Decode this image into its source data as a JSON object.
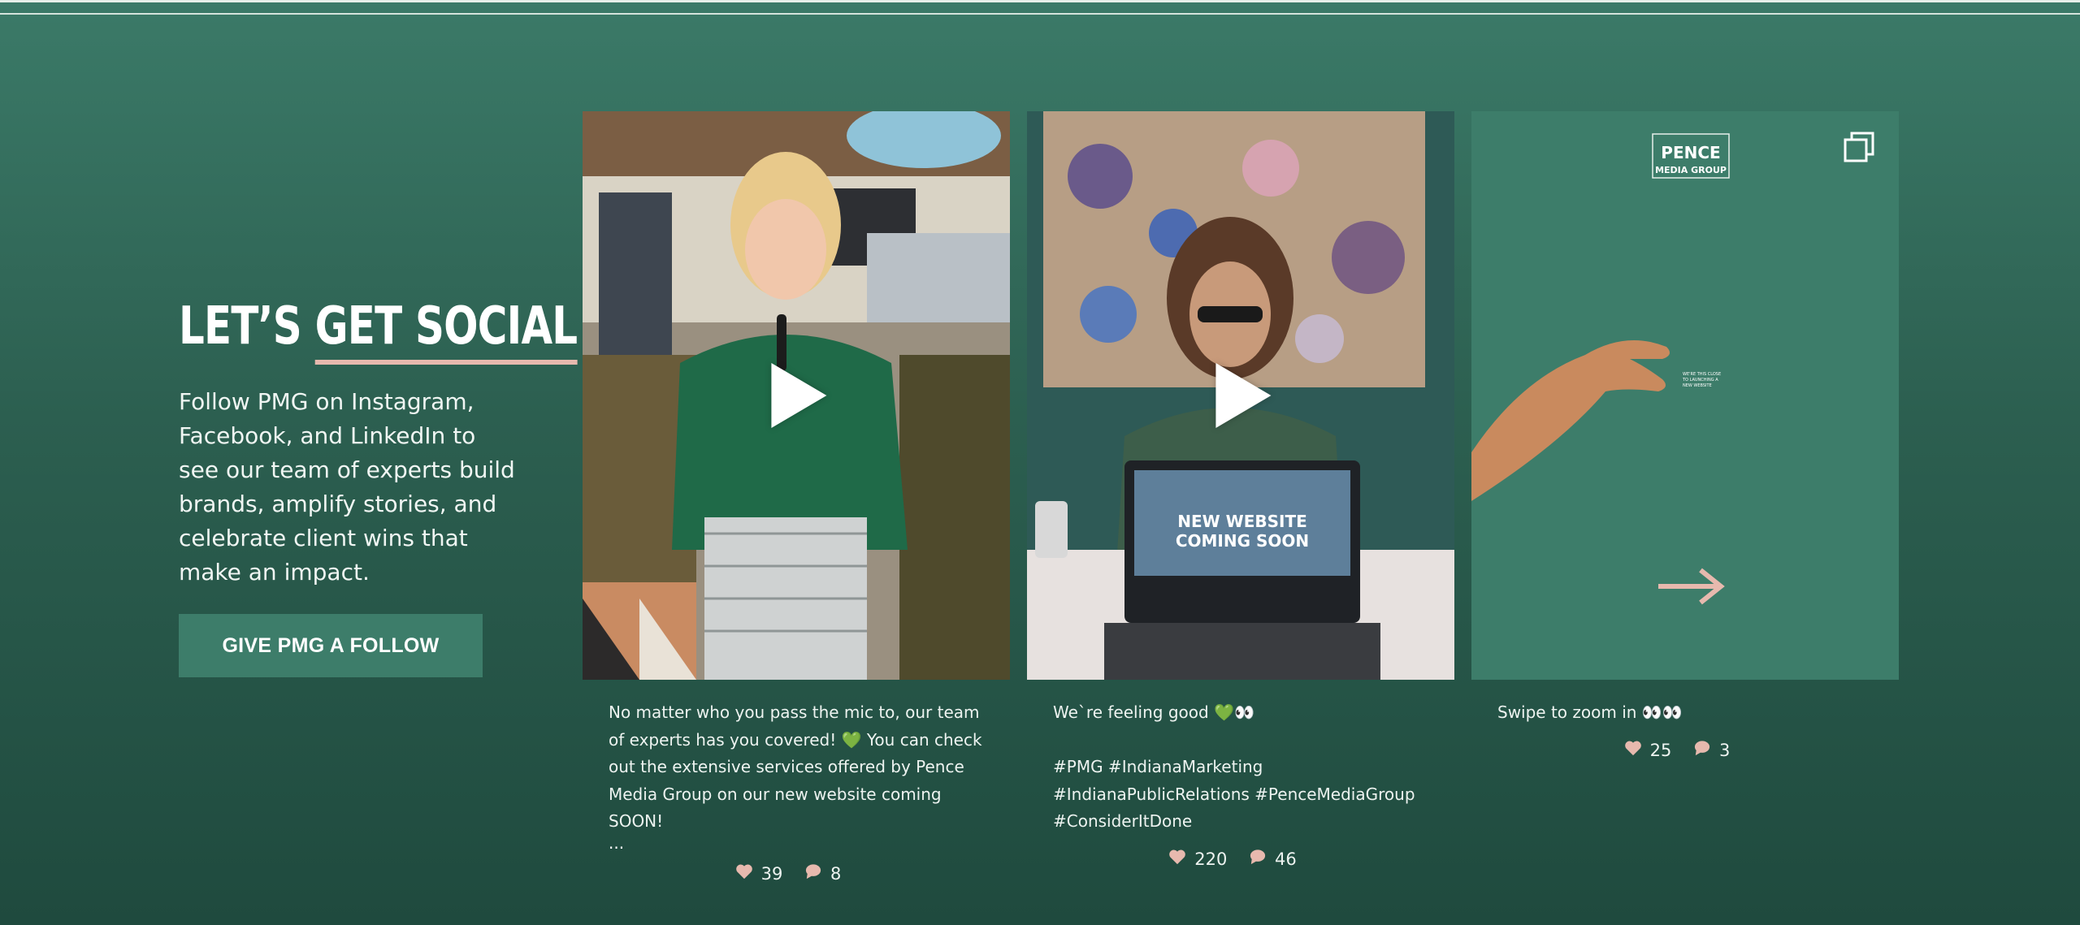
{
  "section": {
    "heading_part1": "LET’S ",
    "heading_part2": "GET SOCIAL",
    "description": "Follow PMG on Instagram, Facebook, and LinkedIn to see our team of experts build brands, amplify stories, and celebrate client wins that make an impact.",
    "follow_button": "GIVE PMG A FOLLOW"
  },
  "colors": {
    "background_top": "#3b7a68",
    "background_bottom": "#1f4a3e",
    "accent_underline": "#e7b9ae",
    "button_bg": "#3d7d6a",
    "card3_bg": "#3d7d6a"
  },
  "posts": [
    {
      "type": "video",
      "caption": "No matter who you pass the mic to, our team of experts has you covered! 💚 You can check out the extensive services offered by Pence Media Group on our new website coming SOON!",
      "more": "...",
      "likes": "39",
      "comments": "8"
    },
    {
      "type": "video",
      "caption": "We`re feeling good 💚👀\n\n#PMG #IndianaMarketing #IndianaPublicRelations #PenceMediaGroup #ConsiderItDone",
      "screen_text": "NEW WEBSITE COMING SOON",
      "likes": "220",
      "comments": "46"
    },
    {
      "type": "carousel",
      "caption": "Swipe to zoom in 👀👀",
      "logo_line1": "PENCE",
      "logo_line2": "MEDIA GROUP",
      "small_text": "WE'RE THIS CLOSE TO LAUNCHING A NEW WEBSITE",
      "likes": "25",
      "comments": "3"
    }
  ]
}
